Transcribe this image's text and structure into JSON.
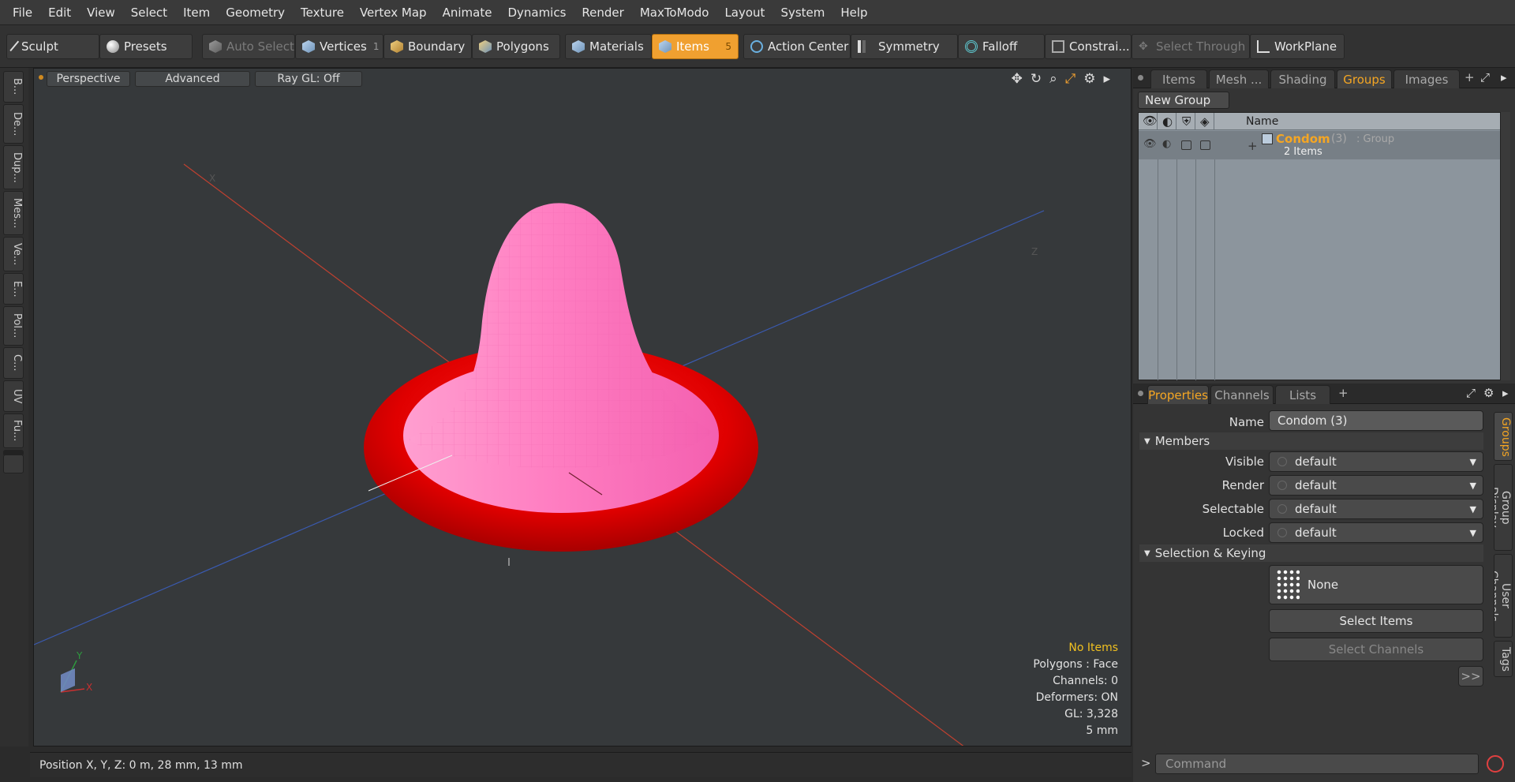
{
  "menu": [
    "File",
    "Edit",
    "View",
    "Select",
    "Item",
    "Geometry",
    "Texture",
    "Vertex Map",
    "Animate",
    "Dynamics",
    "Render",
    "MaxToModo",
    "Layout",
    "System",
    "Help"
  ],
  "toolbar": {
    "sculpt": "Sculpt",
    "presets": "Presets",
    "auto_select": "Auto Select",
    "vertices": "Vertices",
    "vertices_count": "1",
    "boundary": "Boundary",
    "polygons": "Polygons",
    "materials": "Materials",
    "items": "Items",
    "items_count": "5",
    "action_center": "Action Center",
    "symmetry": "Symmetry",
    "falloff": "Falloff",
    "constraints": "Constrai...",
    "select_through": "Select Through",
    "workplane": "WorkPlane"
  },
  "left_tabs": [
    "B...",
    "De...",
    "Dup...",
    "Mes...",
    "Ve...",
    "E...",
    "Pol...",
    "C...",
    "UV",
    "Fu..."
  ],
  "viewport": {
    "perspective": "Perspective",
    "advanced": "Advanced",
    "raygl": "Ray GL: Off",
    "stats": {
      "items": "No Items",
      "polygons": "Polygons : Face",
      "channels": "Channels: 0",
      "deformers": "Deformers: ON",
      "gl": "GL: 3,328",
      "scale": "5 mm"
    },
    "axis_labels": {
      "x": "X",
      "y": "Y",
      "z": "Z"
    }
  },
  "status": {
    "position": "Position X, Y, Z:   0 m, 28 mm, 13 mm"
  },
  "right_panel": {
    "top_tabs": [
      "Items",
      "Mesh ...",
      "Shading",
      "Groups",
      "Images"
    ],
    "new_group": "New Group",
    "list_header": "Name",
    "group": {
      "name": "Condom",
      "count": "(3)",
      "type": ": Group",
      "items": "2 Items"
    },
    "prop_tabs": [
      "Properties",
      "Channels",
      "Lists"
    ],
    "name_label": "Name",
    "name_value": "Condom (3)",
    "members_label": "Members",
    "rows": [
      {
        "label": "Visible",
        "value": "default"
      },
      {
        "label": "Render",
        "value": "default"
      },
      {
        "label": "Selectable",
        "value": "default"
      },
      {
        "label": "Locked",
        "value": "default"
      }
    ],
    "selection_keying": "Selection & Keying",
    "none": "None",
    "select_items": "Select Items",
    "select_channels": "Select Channels",
    "more": ">>",
    "side_tabs": [
      "Groups",
      "Group Display",
      "User Channels",
      "Tags"
    ],
    "command_placeholder": "Command"
  }
}
